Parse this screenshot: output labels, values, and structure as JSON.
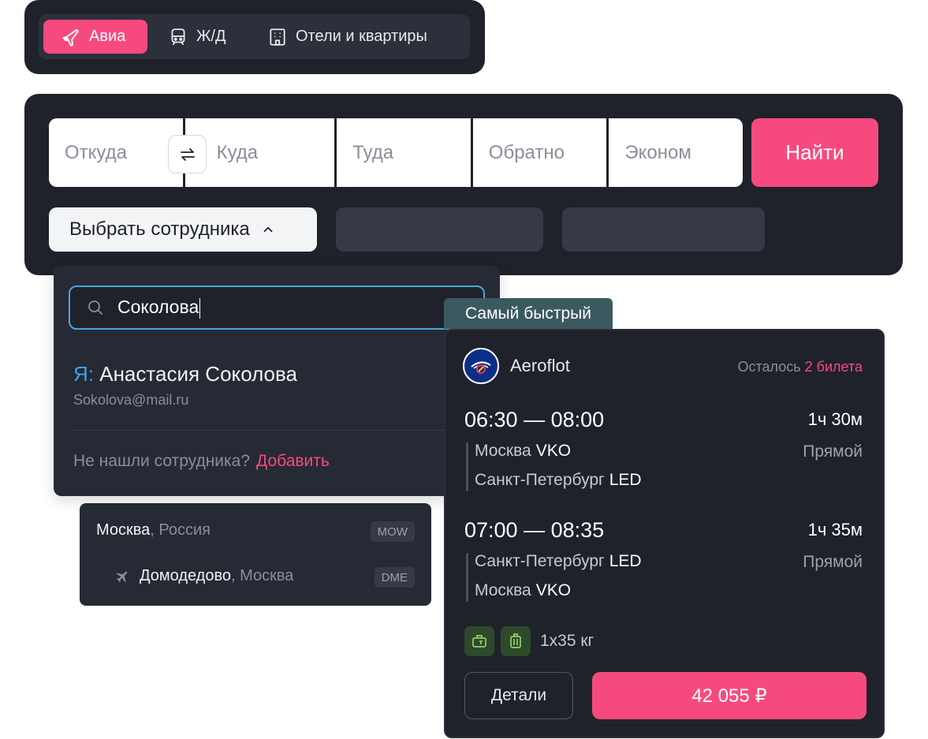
{
  "tabs": [
    {
      "label": "Авиа",
      "icon": "plane-icon"
    },
    {
      "label": "Ж/Д",
      "icon": "train-icon"
    },
    {
      "label": "Отели и квартиры",
      "icon": "building-icon"
    }
  ],
  "search": {
    "from_placeholder": "Откуда",
    "to_placeholder": "Куда",
    "depart_placeholder": "Туда",
    "return_placeholder": "Обратно",
    "class_value": "Эконом",
    "find_label": "Найти",
    "employee_label": "Выбрать сотрудника"
  },
  "employee_dropdown": {
    "query": "Соколова",
    "result_prefix": "Я:",
    "result_name": "Анастасия Соколова",
    "result_email": "Sokolova@mail.ru",
    "not_found": "Не нашли сотрудника?",
    "add_label": "Добавить"
  },
  "city_dropdown": {
    "city": "Москва",
    "country": ", Россия",
    "city_code": "MOW",
    "airport": "Домодедово",
    "airport_city": ", Москва",
    "airport_code": "DME"
  },
  "flight": {
    "badge": "Самый быстрый",
    "airline": "Aeroflot",
    "tickets_left_label": "Осталось",
    "tickets_left_value": "2 билета",
    "segments": [
      {
        "time": "06:30 — 08:00",
        "duration": "1ч 30м",
        "type": "Прямой",
        "from_city": "Москва",
        "from_code": "VKO",
        "to_city": "Санкт-Петербург",
        "to_code": "LED"
      },
      {
        "time": "07:00 — 08:35",
        "duration": "1ч 35м",
        "type": "Прямой",
        "from_city": "Санкт-Петербург",
        "from_code": "LED",
        "to_city": "Москва",
        "to_code": "VKO"
      }
    ],
    "baggage": "1x35 кг",
    "details_label": "Детали",
    "price": "42 055 ₽"
  },
  "colors": {
    "accent": "#f64a7e",
    "panel": "#1f222b",
    "link_blue": "#3ea0e8",
    "badge_teal": "#3b5a5f"
  }
}
